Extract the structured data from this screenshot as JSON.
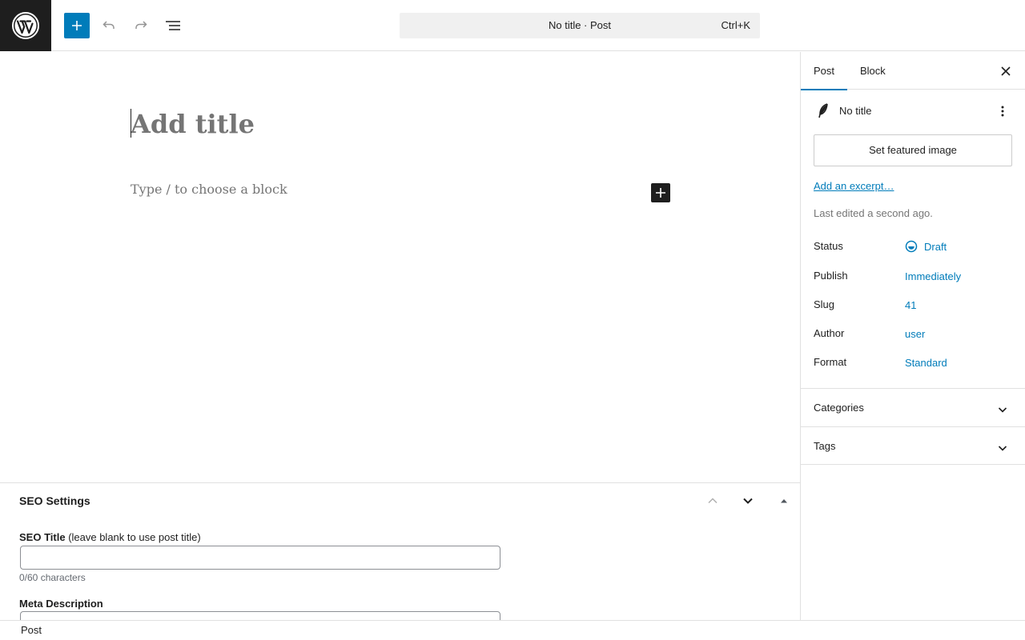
{
  "toolbar": {
    "logo_icon": "wordpress-logo-icon",
    "inserter_icon": "plus-icon",
    "undo_icon": "undo-icon",
    "redo_icon": "redo-icon",
    "list_view_icon": "list-view-icon",
    "document_title": "No title · Post",
    "shortcut": "Ctrl+K"
  },
  "editor": {
    "title_placeholder": "Add title",
    "block_placeholder": "Type / to choose a block",
    "add_block_icon": "plus-icon"
  },
  "metabox": {
    "title": "SEO Settings",
    "seo_title_label": "SEO Title",
    "seo_title_hint": "(leave blank to use post title)",
    "seo_title_value": "",
    "seo_title_count": "0/60 characters",
    "meta_description_label": "Meta Description",
    "meta_description_value": ""
  },
  "sidebar": {
    "tabs": [
      {
        "label": "Post",
        "active": true
      },
      {
        "label": "Block",
        "active": false
      }
    ],
    "post_title": "No title",
    "featured_image_label": "Set featured image",
    "excerpt_link": "Add an excerpt…",
    "last_edited": "Last edited a second ago.",
    "properties": [
      {
        "label": "Status",
        "value": "Draft"
      },
      {
        "label": "Publish",
        "value": "Immediately"
      },
      {
        "label": "Slug",
        "value": "41"
      },
      {
        "label": "Author",
        "value": "user"
      },
      {
        "label": "Format",
        "value": "Standard"
      }
    ],
    "panels": [
      {
        "title": "Categories"
      },
      {
        "title": "Tags"
      }
    ]
  },
  "footer": {
    "breadcrumb": "Post"
  },
  "colors": {
    "accent": "#007cba",
    "dark": "#1e1e1e",
    "muted": "#757575",
    "border": "#e0e0e0"
  }
}
